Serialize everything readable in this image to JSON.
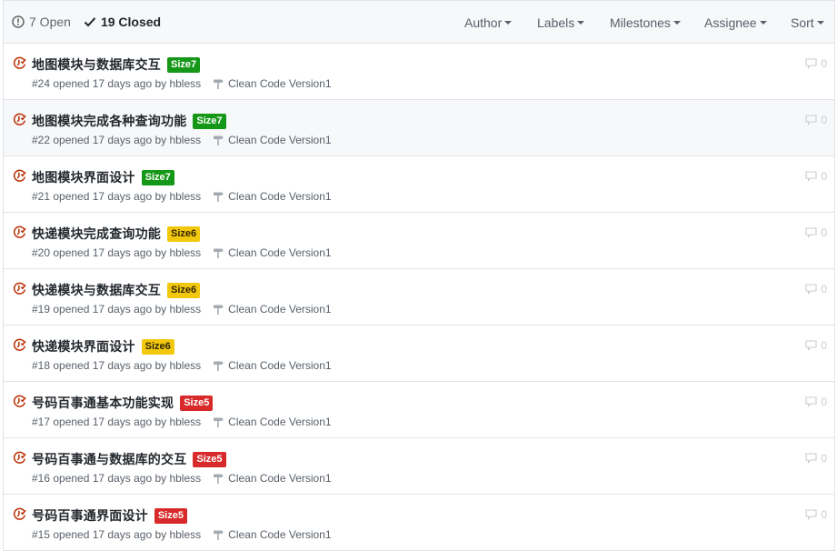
{
  "header": {
    "open_label": "7 Open",
    "closed_label": "19 Closed",
    "filters": [
      "Author",
      "Labels",
      "Milestones",
      "Assignee",
      "Sort"
    ]
  },
  "colors": {
    "Size7": "#159818",
    "Size6": "#f2c80e",
    "Size5": "#d82a2a"
  },
  "issues": [
    {
      "title": "地图模块与数据库交互",
      "label": "Size7",
      "meta": "#24 opened 17 days ago by hbless",
      "milestone": "Clean Code Version1",
      "comments": "0"
    },
    {
      "title": "地图模块完成各种查询功能",
      "label": "Size7",
      "meta": "#22 opened 17 days ago by hbless",
      "milestone": "Clean Code Version1",
      "comments": "0"
    },
    {
      "title": "地图模块界面设计",
      "label": "Size7",
      "meta": "#21 opened 17 days ago by hbless",
      "milestone": "Clean Code Version1",
      "comments": "0"
    },
    {
      "title": "快递模块完成查询功能",
      "label": "Size6",
      "meta": "#20 opened 17 days ago by hbless",
      "milestone": "Clean Code Version1",
      "comments": "0"
    },
    {
      "title": "快递模块与数据库交互",
      "label": "Size6",
      "meta": "#19 opened 17 days ago by hbless",
      "milestone": "Clean Code Version1",
      "comments": "0"
    },
    {
      "title": "快递模块界面设计",
      "label": "Size6",
      "meta": "#18 opened 17 days ago by hbless",
      "milestone": "Clean Code Version1",
      "comments": "0"
    },
    {
      "title": "号码百事通基本功能实现",
      "label": "Size5",
      "meta": "#17 opened 17 days ago by hbless",
      "milestone": "Clean Code Version1",
      "comments": "0"
    },
    {
      "title": "号码百事通与数据库的交互",
      "label": "Size5",
      "meta": "#16 opened 17 days ago by hbless",
      "milestone": "Clean Code Version1",
      "comments": "0"
    },
    {
      "title": "号码百事通界面设计",
      "label": "Size5",
      "meta": "#15 opened 17 days ago by hbless",
      "milestone": "Clean Code Version1",
      "comments": "0"
    }
  ]
}
